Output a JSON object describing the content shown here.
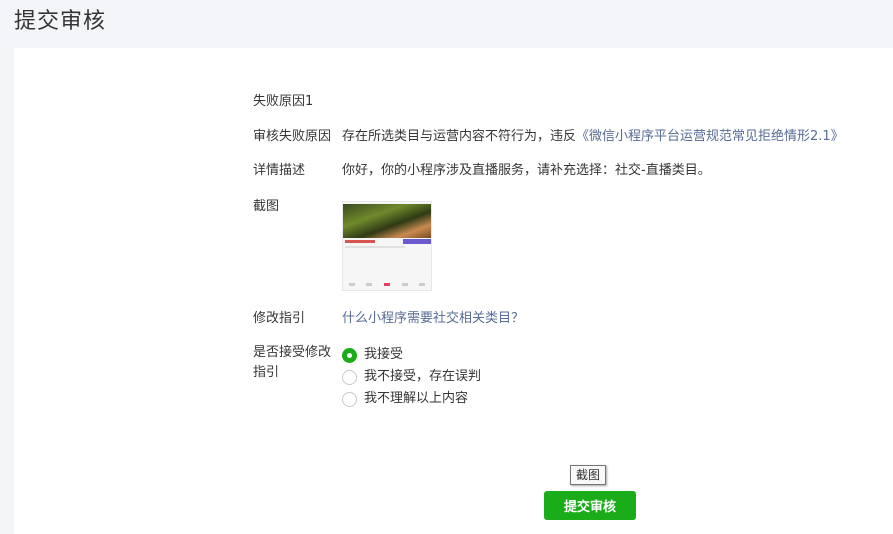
{
  "page": {
    "title": "提交审核"
  },
  "failure": {
    "heading": "失败原因1",
    "reason_label": "审核失败原因",
    "reason_text": "存在所选类目与运营内容不符行为，违反",
    "reason_link": "《微信小程序平台运营规范常见拒绝情形2.1》",
    "detail_label": "详情描述",
    "detail_text": "你好，你的小程序涉及直播服务，请补充选择：社交-直播类目。",
    "screenshot_label": "截图",
    "guide_label": "修改指引",
    "guide_link": "什么小程序需要社交相关类目？",
    "accept_label": "是否接受修改指引",
    "options": [
      {
        "label": "我接受",
        "checked": true
      },
      {
        "label": "我不接受，存在误判",
        "checked": false
      },
      {
        "label": "我不理解以上内容",
        "checked": false
      }
    ]
  },
  "tooltip": "截图",
  "submit_label": "提交审核",
  "colors": {
    "primary": "#1aad19",
    "link": "#576b95",
    "background": "#f4f5f9"
  }
}
